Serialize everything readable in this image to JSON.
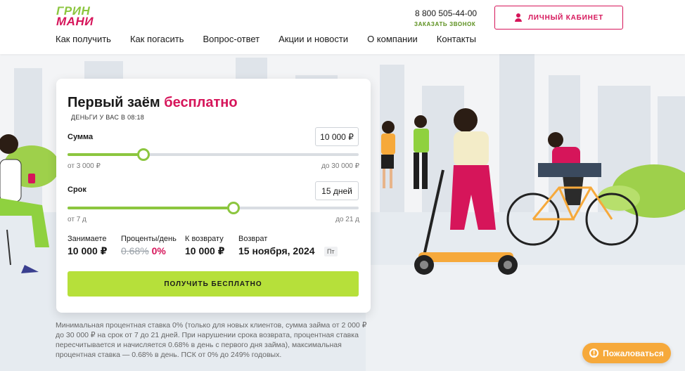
{
  "header": {
    "logo_line1": "ГРИН",
    "logo_line2": "МАНИ",
    "phone": "8 800 505-44-00",
    "callback": "ЗАКАЗАТЬ ЗВОНОК",
    "cabinet_label": "ЛИЧНЫЙ КАБИНЕТ",
    "nav": [
      "Как получить",
      "Как погасить",
      "Вопрос-ответ",
      "Акции и новости",
      "О компании",
      "Контакты"
    ]
  },
  "calculator": {
    "title_main": "Первый заём",
    "title_accent": "бесплатно",
    "money_when": "ДЕНЬГИ У ВАС В 08:18",
    "sum": {
      "label": "Сумма",
      "value": "10 000 ₽",
      "min_label": "от 3 000 ₽",
      "max_label": "до 30 000 ₽",
      "fraction": 0.26
    },
    "term": {
      "label": "Срок",
      "value": "15 дней",
      "min_label": "от 7 д",
      "max_label": "до 21 д",
      "fraction": 0.57
    },
    "stats": {
      "borrow_label": "Занимаете",
      "borrow_value": "10 000 ₽",
      "rate_label": "Проценты/день",
      "rate_old": "0.68%",
      "rate_new": "0%",
      "repay_label": "К возврату",
      "repay_value": "10 000 ₽",
      "return_label": "Возврат",
      "return_date": "15 ноября, 2024",
      "return_weekday": "Пт"
    },
    "cta_label": "ПОЛУЧИТЬ БЕСПЛАТНО"
  },
  "disclaimer": "Минимальная процентная ставка 0% (только для новых клиентов, сумма займа от 2 000 ₽ до 30 000 ₽ на срок от 7 до 21 дней. При нарушении срока возврата, процентная ставка пересчитывается и начисляется 0.68% в день с первого дня займа), максимальная процентная ставка — 0.68% в день. ПСК от 0% до 249% годовых.",
  "complain_label": "Пожаловаться",
  "colors": {
    "brand_pink": "#d6155a",
    "brand_green": "#8cc63f",
    "cta_green": "#b6e03a",
    "complain_orange": "#f6a93b"
  }
}
